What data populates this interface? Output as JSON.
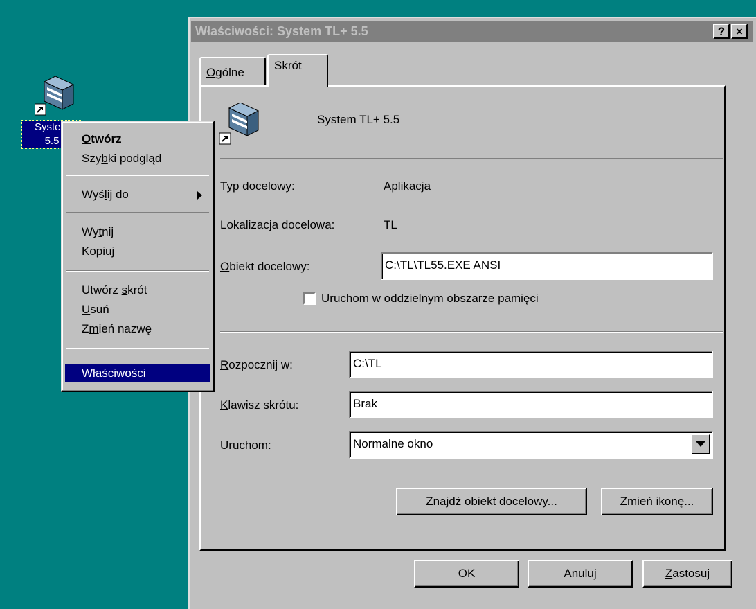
{
  "desktop": {
    "icon_name": "books-shortcut-icon",
    "icon_label_line1": "System",
    "icon_label_line2": "5.5"
  },
  "window": {
    "title": "Właściwości: System TL+ 5.5",
    "help_label": "?",
    "close_label": "×"
  },
  "tabs": [
    {
      "label": "Ogólne",
      "accel": "O",
      "rest": "gólne"
    },
    {
      "label": "Skrót"
    }
  ],
  "shortcut": {
    "name": "System TL+ 5.5",
    "target_type_label": "Typ docelowy:",
    "target_type_value": "Aplikacja",
    "target_location_label": "Lokalizacja docelowa:",
    "target_location_value": "TL",
    "target_label_accel": "O",
    "target_label_rest": "biekt docelowy:",
    "target_value": "C:\\TL\\TL55.EXE  ANSI",
    "separate_memory_pre": "Uruchom w o",
    "separate_memory_accel": "d",
    "separate_memory_post": "dzielnym obszarze pamięci",
    "separate_memory_checked": false,
    "start_in_accel": "R",
    "start_in_rest": "ozpocznij w:",
    "start_in_value": "C:\\TL",
    "hotkey_accel": "K",
    "hotkey_rest": "lawisz skrótu:",
    "hotkey_value": "Brak",
    "run_accel": "U",
    "run_rest": "ruchom:",
    "run_value": "Normalne okno",
    "find_target_pre": "Z",
    "find_target_accel": "n",
    "find_target_post": "ajdź obiekt docelowy...",
    "change_icon_pre": "Z",
    "change_icon_accel": "m",
    "change_icon_post": "ień ikonę..."
  },
  "footer": {
    "ok": "OK",
    "cancel": "Anuluj",
    "apply_accel": "Z",
    "apply_rest": "astosuj"
  },
  "context_menu": {
    "open_accel": "O",
    "open_rest": "twórz",
    "quickview_pre": "Szy",
    "quickview_accel": "b",
    "quickview_post": "ki podgląd",
    "sendto_pre": "Wyś",
    "sendto_accel": "l",
    "sendto_post": "ij do",
    "cut_pre": "Wy",
    "cut_accel": "t",
    "cut_post": "nij",
    "copy_accel": "K",
    "copy_rest": "opiuj",
    "create_shortcut_pre": "Utwórz ",
    "create_shortcut_accel": "s",
    "create_shortcut_post": "krót",
    "delete_accel": "U",
    "delete_rest": "suń",
    "rename_pre": "Z",
    "rename_accel": "m",
    "rename_post": "ień nazwę",
    "properties_accel": "W",
    "properties_rest": "łaściwości"
  }
}
